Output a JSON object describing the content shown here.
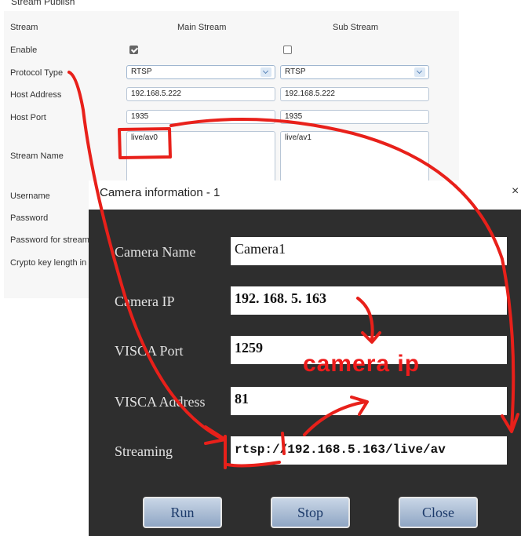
{
  "web_form": {
    "section_title": "Stream Publish",
    "column_headers": {
      "label": "Stream",
      "main": "Main Stream",
      "sub": "Sub Stream"
    },
    "rows": {
      "enable": {
        "label": "Enable",
        "main_checked": true,
        "sub_checked": false
      },
      "protocol": {
        "label": "Protocol Type",
        "main": "RTSP",
        "sub": "RTSP"
      },
      "host_address": {
        "label": "Host Address",
        "main": "192.168.5.222",
        "sub": "192.168.5.222"
      },
      "host_port": {
        "label": "Host Port",
        "main": "1935",
        "sub": "1935"
      },
      "stream_name": {
        "label": "Stream Name",
        "main": "live/av0",
        "sub": "live/av1"
      },
      "username": {
        "label": "Username"
      },
      "password": {
        "label": "Password"
      },
      "password_encrypt": {
        "label": "Password for stream e"
      },
      "crypto_key": {
        "label": "Crypto key length in by"
      }
    }
  },
  "dialog": {
    "title": "Camera information  -  1",
    "close_glyph": "×",
    "fields": {
      "camera_name": {
        "label": "Camera Name",
        "value": "Camera1"
      },
      "camera_ip": {
        "label": "Camera IP",
        "value": "192. 168. 5. 163"
      },
      "visca_port": {
        "label": "VISCA Port",
        "value": "1259"
      },
      "visca_address": {
        "label": "VISCA Address",
        "value": "81"
      },
      "streaming": {
        "label": "Streaming",
        "value": "rtsp://192.168.5.163/live/av"
      }
    },
    "buttons": {
      "run": "Run",
      "stop": "Stop",
      "close": "Close"
    }
  },
  "annotation": {
    "text": "camera ip",
    "color": "#ee1b1b"
  }
}
